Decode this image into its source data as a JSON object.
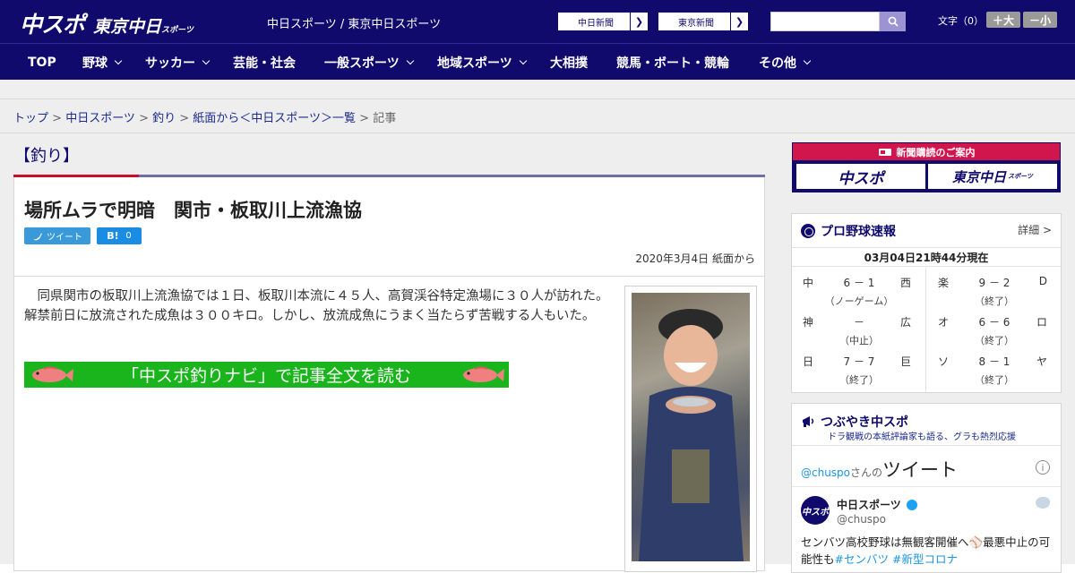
{
  "header": {
    "logo_main": "中スポ",
    "logo_tokyo": "東京中日",
    "logo_sports": "スポーツ",
    "site_name": "中日スポーツ / 東京中日スポーツ",
    "paper_links": [
      {
        "label": "中日新聞"
      },
      {
        "label": "東京新聞"
      }
    ],
    "search_placeholder": "",
    "font_size_label": "文字（0）",
    "font_bigger": "＋大",
    "font_smaller": "－小"
  },
  "nav": {
    "items": [
      {
        "label": "TOP",
        "dropdown": false
      },
      {
        "label": "野球",
        "dropdown": true
      },
      {
        "label": "サッカー",
        "dropdown": true
      },
      {
        "label": "芸能・社会",
        "dropdown": false
      },
      {
        "label": "一般スポーツ",
        "dropdown": true
      },
      {
        "label": "地域スポーツ",
        "dropdown": true
      },
      {
        "label": "大相撲",
        "dropdown": false
      },
      {
        "label": "競馬・ボート・競輪",
        "dropdown": false
      },
      {
        "label": "その他",
        "dropdown": true
      }
    ]
  },
  "breadcrumb": {
    "items": [
      "トップ",
      "中日スポーツ",
      "釣り",
      "紙面から＜中日スポーツ＞一覧"
    ],
    "separator": " > ",
    "current": "記事"
  },
  "article": {
    "category": "【釣り】",
    "headline": "場所ムラで明暗　関市・板取川上流漁協",
    "tweet_label": "ツイート",
    "hatena_label": "B!",
    "hatena_count": "0",
    "date": "2020年3月4日 紙面から",
    "body": "　同県関市の板取川上流漁協では１日、板取川本流に４５人、高賀渓谷特定漁場に３０人が訪れた。解禁前日に放流された成魚は３００キロ。しかし、放流成魚にうまく当たらず苦戦する人もいた。",
    "readmore": "「中スポ釣りナビ」で記事全文を読む"
  },
  "sidebar": {
    "subscription": {
      "title": "新聞購読のご案内",
      "logo_left": "中スポ",
      "logo_right": "東京中日",
      "logo_right_small": "スポーツ"
    },
    "baseball": {
      "title": "プロ野球速報",
      "detail": "詳細 >",
      "timestamp": "03月04日21時44分現在",
      "left_games": [
        {
          "home": "中",
          "score": "6 － 1",
          "away": "西",
          "status": "（ノーゲーム）"
        },
        {
          "home": "神",
          "score": "－",
          "away": "広",
          "status": "（中止）"
        },
        {
          "home": "日",
          "score": "7 － 7",
          "away": "巨",
          "status": "（終了）"
        }
      ],
      "right_games": [
        {
          "home": "楽",
          "score": "9 － 2",
          "away": "D",
          "status": "（終了）"
        },
        {
          "home": "オ",
          "score": "6 － 6",
          "away": "ロ",
          "status": "（終了）"
        },
        {
          "home": "ソ",
          "score": "8 － 1",
          "away": "ヤ",
          "status": "（終了）"
        }
      ]
    },
    "twitter": {
      "title": "つぶやき中スポ",
      "subtitle": "ドラ観戦の本紙評論家も語る、グラも熱烈応援",
      "handle": "@chuspo",
      "handle_suffix": "さんの",
      "handle_big": "ツイート",
      "info_icon": "i",
      "avatar_text": "中スポ",
      "account_name": "中日スポーツ",
      "account_id": "@chuspo",
      "tweet_text_1": "センバツ高校野球は無観客開催へ",
      "tweet_text_2": "最悪中止の可能性も",
      "tags": [
        "#センバツ",
        "#新型コロナ"
      ]
    }
  }
}
